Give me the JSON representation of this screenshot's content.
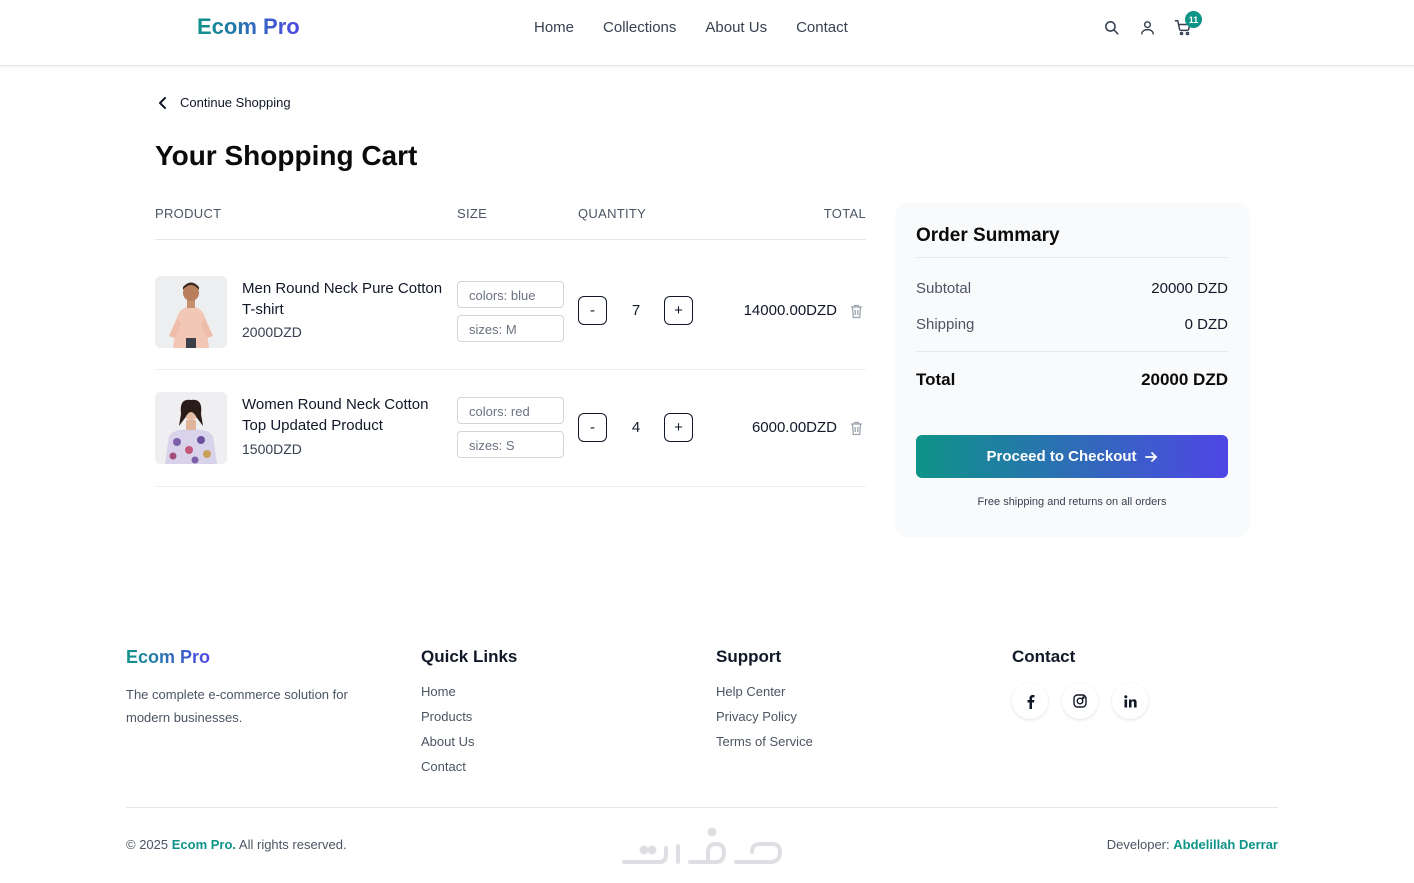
{
  "brand": {
    "name": "Ecom Pro",
    "gradient_from": "#0d9488",
    "gradient_to": "#4f46e5"
  },
  "nav": {
    "items": [
      "Home",
      "Collections",
      "About Us",
      "Contact"
    ]
  },
  "header_icons": {
    "search": "search-icon",
    "user": "user-icon",
    "cart": "cart-icon",
    "cart_count": "11"
  },
  "back_link": {
    "label": "Continue Shopping"
  },
  "page_title": "Your Shopping Cart",
  "table": {
    "headers": {
      "product": "PRODUCT",
      "size": "SIZE",
      "quantity": "QUANTITY",
      "total": "TOTAL"
    }
  },
  "cart_items": [
    {
      "name": "Men Round Neck Pure Cotton T-shirt",
      "price": "2000DZD",
      "color": "colors: blue",
      "size": "sizes: M",
      "quantity": "7",
      "total": "14000.00DZD"
    },
    {
      "name": "Women Round Neck Cotton Top Updated Product",
      "price": "1500DZD",
      "color": "colors: red",
      "size": "sizes: S",
      "quantity": "4",
      "total": "6000.00DZD"
    }
  ],
  "qty_controls": {
    "minus": "-",
    "plus": "+"
  },
  "summary": {
    "title": "Order Summary",
    "subtotal_label": "Subtotal",
    "subtotal_value": "20000 DZD",
    "shipping_label": "Shipping",
    "shipping_value": "0 DZD",
    "total_label": "Total",
    "total_value": "20000 DZD",
    "checkout_label": "Proceed to Checkout",
    "shipping_note": "Free shipping and returns on all orders"
  },
  "footer": {
    "brand": "Ecom Pro",
    "description": "The complete e-commerce solution for modern businesses.",
    "quick_links": {
      "title": "Quick Links",
      "items": [
        "Home",
        "Products",
        "About Us",
        "Contact"
      ]
    },
    "support": {
      "title": "Support",
      "items": [
        "Help Center",
        "Privacy Policy",
        "Terms of Service"
      ]
    },
    "contact": {
      "title": "Contact",
      "social": [
        "facebook-icon",
        "instagram-icon",
        "linkedin-icon"
      ]
    },
    "copyright_prefix": "© 2025 ",
    "copyright_brand": "Ecom Pro.",
    "copyright_suffix": " All rights reserved.",
    "developer_label": "Developer: ",
    "developer_name": "Abdelillah Derrar"
  }
}
